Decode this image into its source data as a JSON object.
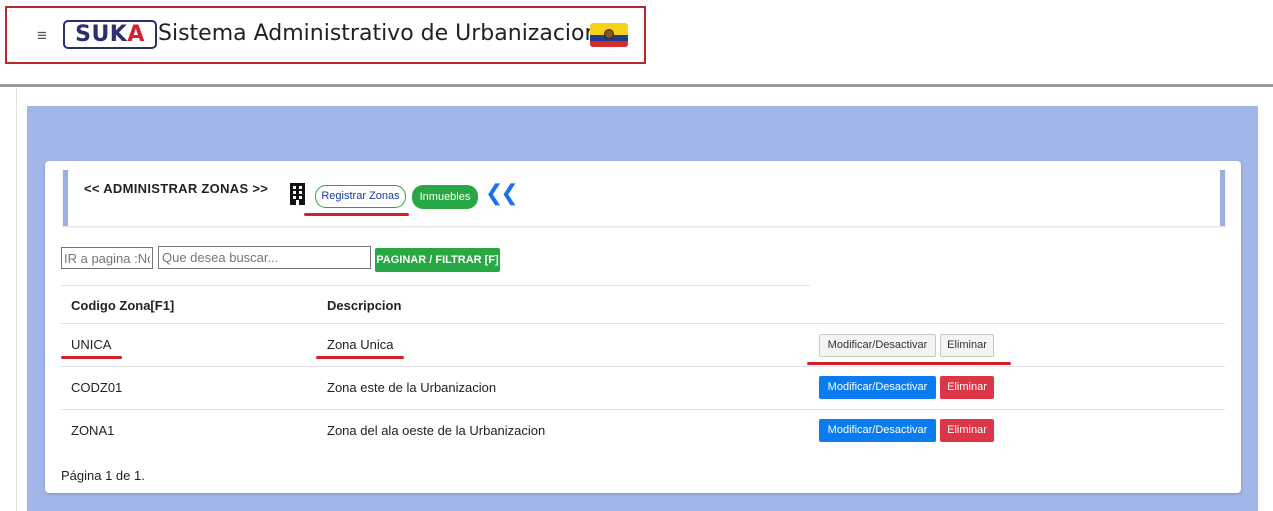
{
  "header": {
    "menu_icon": "hamburger-icon",
    "logo": {
      "part1": "SUK",
      "part2": "A"
    },
    "title": "Sistema Administrativo de Urbanizaciones",
    "flag_icon": "ecuador-flag-icon"
  },
  "toolbar": {
    "title": "<< ADMINISTRAR ZONAS >>",
    "building_icon": "building-icon",
    "register_label": "Registrar Zonas",
    "inmuebles_label": "Inmuebles",
    "collapse_icon": "double-chevron-left-icon"
  },
  "filter": {
    "page_placeholder": "IR a pagina :No",
    "search_placeholder": "Que desea buscar...",
    "button_label": "PAGINAR / FILTRAR [F]"
  },
  "table": {
    "headers": [
      "Codigo Zona[F1]",
      "Descripcion"
    ],
    "rows": [
      {
        "code": "UNICA",
        "description": "Zona Unica",
        "modify": "Modificar/Desactivar",
        "delete": "Eliminar"
      },
      {
        "code": "CODZ01",
        "description": "Zona este de la Urbanizacion",
        "modify": "Modificar/Desactivar",
        "delete": "Eliminar"
      },
      {
        "code": "ZONA1",
        "description": "Zona del ala oeste de la Urbanizacion",
        "modify": "Modificar/Desactivar",
        "delete": "Eliminar"
      }
    ]
  },
  "pagination": {
    "text": "Página 1 de 1."
  },
  "colors": {
    "header_border": "#b52a2a",
    "panel_blue": "#a2b6ea",
    "success": "#28a745",
    "primary": "#0a7cf0",
    "danger": "#dc3545",
    "annotation": "#d4202a"
  }
}
